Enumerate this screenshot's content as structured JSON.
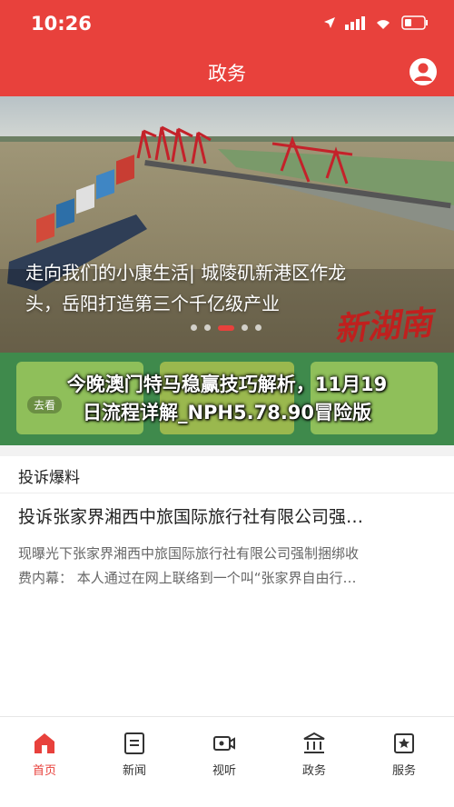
{
  "status_bar": {
    "time": "10:26",
    "icons": [
      "location-arrow-icon",
      "signal-icon",
      "wifi-icon",
      "battery-icon"
    ]
  },
  "nav": {
    "title": "政务",
    "user_icon": "user-avatar-icon"
  },
  "banner": {
    "caption_line1": "走向我们的小康生活| 城陵矶新港区作龙",
    "caption_line2": "头，岳阳打造第三个千亿级产业",
    "brand": "新湖南",
    "slide_count": 5,
    "active_slide": 3
  },
  "mid_strip": {
    "tile_label": "去看"
  },
  "overlay_headline": {
    "line1": "今晚澳门特马稳赢技巧解析，11月19",
    "line2": "日流程详解_NPH5.78.90冒险版"
  },
  "section": {
    "title": "投诉爆料",
    "article_title": "投诉张家界湘西中旅国际旅行社有限公司强…",
    "article_summary_line1": "现曝光下张家界湘西中旅国际旅行社有限公司强制捆绑收",
    "article_summary_line2": "费内幕：  本人通过在网上联络到一个叫“张家界自由行…"
  },
  "tabs": [
    {
      "label": "首页",
      "icon": "home-icon",
      "active": true
    },
    {
      "label": "新闻",
      "icon": "news-icon",
      "active": false
    },
    {
      "label": "视听",
      "icon": "video-icon",
      "active": false
    },
    {
      "label": "政务",
      "icon": "government-icon",
      "active": false
    },
    {
      "label": "服务",
      "icon": "service-icon",
      "active": false
    }
  ],
  "colors": {
    "brand_red": "#e8413c",
    "text_dark": "#222222",
    "text_gray": "#666666"
  }
}
